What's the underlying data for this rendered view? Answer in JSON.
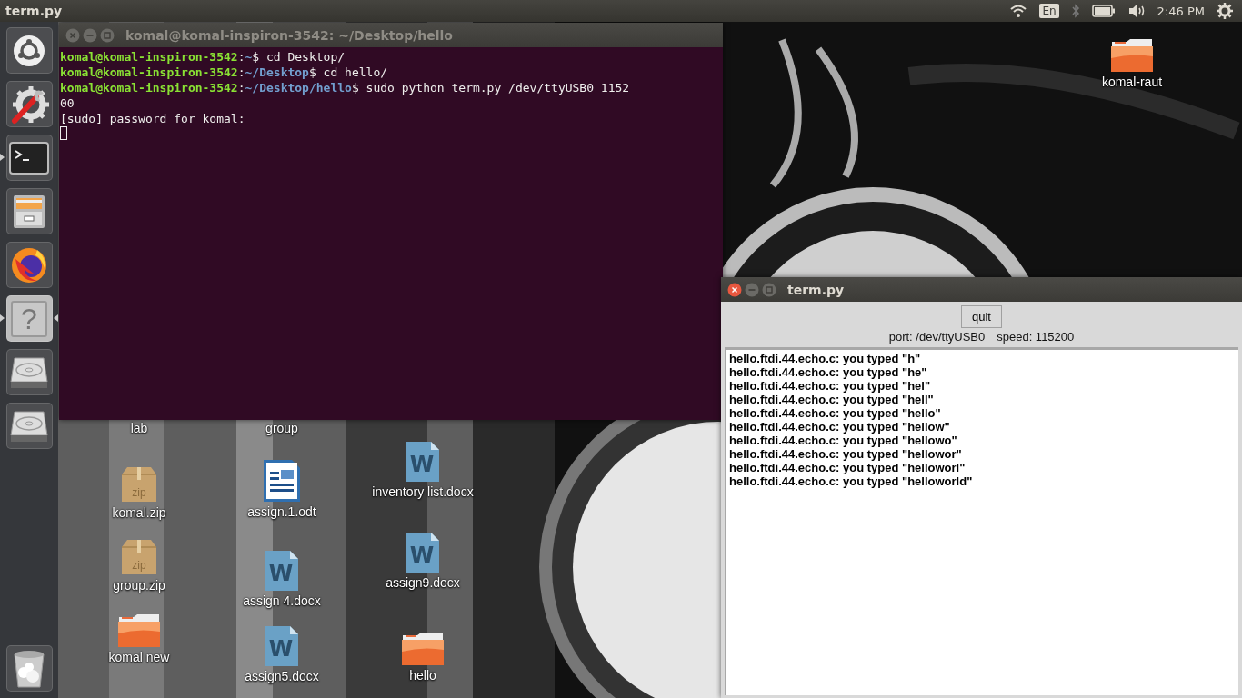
{
  "top_panel": {
    "app_title": "term.py",
    "indicators": [
      {
        "kind": "wifi"
      },
      {
        "kind": "keyboard",
        "label": "En"
      },
      {
        "kind": "bluetooth"
      },
      {
        "kind": "battery"
      },
      {
        "kind": "volume"
      },
      {
        "kind": "clock",
        "label": "2:46 PM"
      },
      {
        "kind": "session"
      }
    ]
  },
  "launcher": {
    "items": [
      {
        "kind": "dash",
        "running": false,
        "focused": false
      },
      {
        "kind": "settings",
        "running": false,
        "focused": false
      },
      {
        "kind": "terminal",
        "running": true,
        "focused": false
      },
      {
        "kind": "files",
        "running": false,
        "focused": false
      },
      {
        "kind": "firefox",
        "running": false,
        "focused": false
      },
      {
        "kind": "help",
        "glyph": "?",
        "running": true,
        "focused": true
      },
      {
        "kind": "drive",
        "running": false,
        "focused": false
      },
      {
        "kind": "drive",
        "running": false,
        "focused": false
      },
      {
        "kind": "trash",
        "running": false,
        "focused": false
      }
    ]
  },
  "desktop": {
    "icons": [
      {
        "label": "komal-raut",
        "kind": "folder"
      },
      {
        "label": "lab"
      },
      {
        "label": "group"
      },
      {
        "label": "komal.zip",
        "kind": "zip",
        "icon_text": "zip"
      },
      {
        "label": "assign.1.odt",
        "kind": "odt"
      },
      {
        "label": "inventory list.docx",
        "kind": "word",
        "icon_text": "W"
      },
      {
        "label": "group.zip",
        "kind": "zip",
        "icon_text": "zip"
      },
      {
        "label": "assign 4.docx",
        "kind": "word",
        "icon_text": "W"
      },
      {
        "label": "assign9.docx",
        "kind": "word",
        "icon_text": "W"
      },
      {
        "label": "komal new",
        "kind": "folder"
      },
      {
        "label": "assign5.docx",
        "kind": "word",
        "icon_text": "W"
      },
      {
        "label": "hello",
        "kind": "folder"
      }
    ]
  },
  "terminal_window": {
    "title": "komal@komal-inspiron-3542: ~/Desktop/hello",
    "focused": false,
    "cursor": true,
    "lines": [
      {
        "kind": "prompt",
        "user": "komal@komal-inspiron-3542",
        "separator": ":",
        "path": "~",
        "command": "$ cd Desktop/"
      },
      {
        "kind": "prompt",
        "user": "komal@komal-inspiron-3542",
        "separator": ":",
        "path": "~/Desktop",
        "command": "$ cd hello/"
      },
      {
        "kind": "prompt",
        "user": "komal@komal-inspiron-3542",
        "separator": ":",
        "path": "~/Desktop/hello",
        "command": "$ sudo python term.py /dev/ttyUSB0 1152"
      },
      {
        "kind": "output",
        "text": "00"
      },
      {
        "kind": "output",
        "text": "[sudo] password for komal:"
      }
    ]
  },
  "term_app_window": {
    "title": "term.py",
    "focused": true,
    "quit_button": "quit",
    "port": "port: /dev/ttyUSB0",
    "speed": "speed: 115200",
    "output_lines": [
      "hello.ftdi.44.echo.c: you typed \"h\"",
      "hello.ftdi.44.echo.c: you typed \"he\"",
      "hello.ftdi.44.echo.c: you typed \"hel\"",
      "hello.ftdi.44.echo.c: you typed \"hell\"",
      "hello.ftdi.44.echo.c: you typed \"hello\"",
      "hello.ftdi.44.echo.c: you typed \"hellow\"",
      "hello.ftdi.44.echo.c: you typed \"hellowo\"",
      "hello.ftdi.44.echo.c: you typed \"hellowor\"",
      "hello.ftdi.44.echo.c: you typed \"helloworl\"",
      "hello.ftdi.44.echo.c: you typed \"helloworld\""
    ]
  }
}
